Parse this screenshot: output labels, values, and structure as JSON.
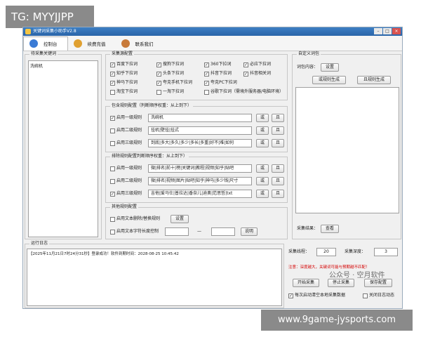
{
  "watermark_top": "TG: MYYJJPP",
  "watermark_bottom": "www.9game-jysports.com",
  "window": {
    "title": "关键词采集小助手V2.8",
    "min": "–",
    "max": "□",
    "close": "×"
  },
  "tabs": [
    {
      "label": "控制台",
      "icon": "console-icon",
      "color": "#3a7bd5"
    },
    {
      "label": "续费充值",
      "icon": "recharge-icon",
      "color": "#e0a030"
    },
    {
      "label": "联系我们",
      "icon": "contact-icon",
      "color": "#c87a3a"
    }
  ],
  "seed_panel": {
    "title": "待采集关键词",
    "content": "洗碗机"
  },
  "source_panel": {
    "title": "采集源配置",
    "items": [
      {
        "label": "百度下拉词",
        "checked": true
      },
      {
        "label": "搜狗下拉词",
        "checked": true
      },
      {
        "label": "360下拉词",
        "checked": true
      },
      {
        "label": "必应下拉词",
        "checked": true
      },
      {
        "label": "知乎下拉词",
        "checked": true
      },
      {
        "label": "头条下拉词",
        "checked": true
      },
      {
        "label": "抖音下拉词",
        "checked": true
      },
      {
        "label": "抖音相关词",
        "checked": true
      },
      {
        "label": "神马下拉词",
        "checked": true
      },
      {
        "label": "夸克手机下拉词",
        "checked": true
      },
      {
        "label": "夸克PC下拉词",
        "checked": true
      },
      {
        "label": "",
        "checked": false
      },
      {
        "label": "淘宝下拉词",
        "checked": false
      },
      {
        "label": "一淘下拉词",
        "checked": false
      },
      {
        "label": "谷歌下拉词（需境外服务器/电脑环境）",
        "checked": false
      }
    ]
  },
  "include_panel": {
    "title": "包含规则配置（判断顺序权重：从上到下）",
    "rows": [
      {
        "label": "启用一级规则",
        "checked": true,
        "value": "洗碗机"
      },
      {
        "label": "启用二级规则",
        "checked": false,
        "value": "挂机|壁挂|挂式"
      },
      {
        "label": "启用三级规则",
        "checked": false,
        "value": "到底|多大|多久|多少|多长|多重|好不|难|如何"
      }
    ],
    "or_label": "或",
    "and_label": "且"
  },
  "exclude_panel": {
    "title": "排除规则配置判断顺序权重：从上到下）",
    "rows": [
      {
        "label": "启用一级规则",
        "checked": false,
        "value": "微|排名|前十|榜|关键词|教程|视频|知乎|贴吧"
      },
      {
        "label": "启用二级规则",
        "checked": false,
        "value": "微|排名|视频|图片|贴吧|知乎|神马|多少钱|尺寸"
      },
      {
        "label": "启用三级规则",
        "checked": true,
        "value": "吉他|爱马仕|普拉达|香奈儿|迪奥|范思哲|txt"
      }
    ],
    "or_label": "或",
    "and_label": "且"
  },
  "other_panel": {
    "title": "其他规则配置",
    "replace_label": "启用文本删除/替换规则",
    "replace_button": "设置",
    "length_label": "启用文本字符长度控制",
    "dash": "—",
    "length_button": "说明"
  },
  "custom_panel": {
    "title": "自定义词包",
    "content_label": "词包内容：",
    "settings_button": "设置",
    "or_button": "或规则生成",
    "and_button": "且规则生成"
  },
  "result": {
    "label": "采集结果：",
    "button": "查看"
  },
  "log_panel": {
    "title": "运行日志",
    "line": "【2025年11月21日7时24分31秒】登录成功！软件到期时间：2028-08-25 10:45:42"
  },
  "controls": {
    "threads_label": "采集线程：",
    "threads_value": "20",
    "depth_label": "采集深度：",
    "depth_value": "3",
    "warning": "注意：深度越大，关键词可能与预期越不匹配！",
    "start_button": "开始采集",
    "stop_button": "停止采集",
    "save_button": "保存配置",
    "clear_label": "每次启动清空本地采集数据",
    "clear_checked": true,
    "close_log_label": "关闭日志动态",
    "close_log_checked": false,
    "public_watermark": "公众号 · 空月软件"
  }
}
